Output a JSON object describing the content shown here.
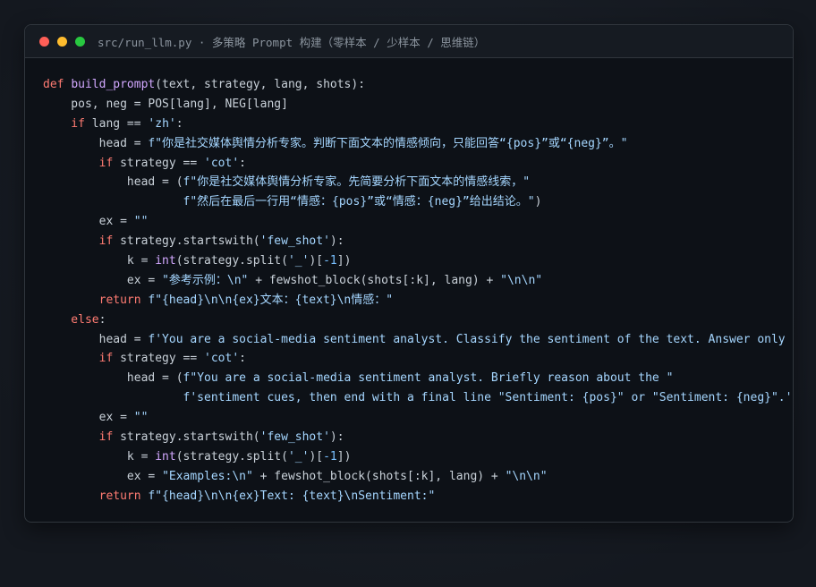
{
  "window": {
    "title": "src/run_llm.py · 多策略 Prompt 构建（零样本 / 少样本 / 思维链）"
  },
  "code_lines": [
    [
      [
        "kw",
        "def "
      ],
      [
        "fn",
        "build_prompt"
      ],
      [
        "pl",
        "(text, strategy, lang, shots):"
      ]
    ],
    [
      [
        "pl",
        "    pos, neg = POS[lang], NEG[lang]"
      ]
    ],
    [
      [
        "kw",
        "    if "
      ],
      [
        "pl",
        "lang == "
      ],
      [
        "str",
        "'zh'"
      ],
      [
        "pl",
        ":"
      ]
    ],
    [
      [
        "pl",
        "        head = "
      ],
      [
        "str",
        "f\"你是社交媒体舆情分析专家。判断下面文本的情感倾向，只能回答“{pos}”或“{neg}”。\""
      ]
    ],
    [
      [
        "kw",
        "        if "
      ],
      [
        "pl",
        "strategy == "
      ],
      [
        "str",
        "'cot'"
      ],
      [
        "pl",
        ":"
      ]
    ],
    [
      [
        "pl",
        "            head = ("
      ],
      [
        "str",
        "f\"你是社交媒体舆情分析专家。先简要分析下面文本的情感线索，\""
      ]
    ],
    [
      [
        "str",
        "                    f\"然后在最后一行用“情感：{pos}”或“情感：{neg}”给出结论。\""
      ],
      [
        "pl",
        ")"
      ]
    ],
    [
      [
        "pl",
        "        ex = "
      ],
      [
        "str",
        "\"\""
      ]
    ],
    [
      [
        "kw",
        "        if "
      ],
      [
        "pl",
        "strategy.startswith("
      ],
      [
        "str",
        "'few_shot'"
      ],
      [
        "pl",
        "):"
      ]
    ],
    [
      [
        "pl",
        "            k = "
      ],
      [
        "bi",
        "int"
      ],
      [
        "pl",
        "(strategy.split("
      ],
      [
        "str",
        "'_'"
      ],
      [
        "pl",
        ")["
      ],
      [
        "num",
        "-1"
      ],
      [
        "pl",
        "])"
      ]
    ],
    [
      [
        "pl",
        "            ex = "
      ],
      [
        "str",
        "\"参考示例：\\n\""
      ],
      [
        "pl",
        " + fewshot_block(shots[:k], lang) + "
      ],
      [
        "str",
        "\"\\n\\n\""
      ]
    ],
    [
      [
        "kw",
        "        return "
      ],
      [
        "str",
        "f\"{head}\\n\\n{ex}文本：{text}\\n情感：\""
      ]
    ],
    [
      [
        "kw",
        "    else"
      ],
      [
        "pl",
        ":"
      ]
    ],
    [
      [
        "pl",
        "        head = "
      ],
      [
        "str",
        "f'You are a social-media sentiment analyst. Classify the sentiment of the text. Answer only \"{pos}\" or \"{neg}\".'"
      ]
    ],
    [
      [
        "kw",
        "        if "
      ],
      [
        "pl",
        "strategy == "
      ],
      [
        "str",
        "'cot'"
      ],
      [
        "pl",
        ":"
      ]
    ],
    [
      [
        "pl",
        "            head = ("
      ],
      [
        "str",
        "f\"You are a social-media sentiment analyst. Briefly reason about the \""
      ]
    ],
    [
      [
        "str",
        "                    f'sentiment cues, then end with a final line \"Sentiment: {pos}\" or \"Sentiment: {neg}\".'"
      ],
      [
        "pl",
        ")"
      ]
    ],
    [
      [
        "pl",
        "        ex = "
      ],
      [
        "str",
        "\"\""
      ]
    ],
    [
      [
        "kw",
        "        if "
      ],
      [
        "pl",
        "strategy.startswith("
      ],
      [
        "str",
        "'few_shot'"
      ],
      [
        "pl",
        "):"
      ]
    ],
    [
      [
        "pl",
        "            k = "
      ],
      [
        "bi",
        "int"
      ],
      [
        "pl",
        "(strategy.split("
      ],
      [
        "str",
        "'_'"
      ],
      [
        "pl",
        ")["
      ],
      [
        "num",
        "-1"
      ],
      [
        "pl",
        "])"
      ]
    ],
    [
      [
        "pl",
        "            ex = "
      ],
      [
        "str",
        "\"Examples:\\n\""
      ],
      [
        "pl",
        " + fewshot_block(shots[:k], lang) + "
      ],
      [
        "str",
        "\"\\n\\n\""
      ]
    ],
    [
      [
        "kw",
        "        return "
      ],
      [
        "str",
        "f\"{head}\\n\\n{ex}Text: {text}\\nSentiment:\""
      ]
    ]
  ]
}
